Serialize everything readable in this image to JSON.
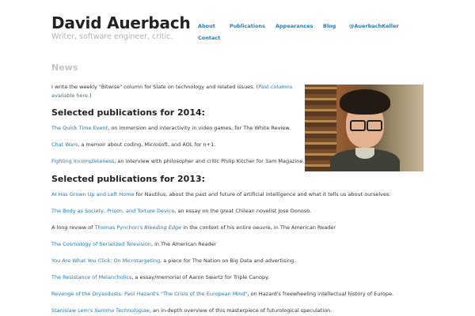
{
  "header": {
    "title": "David Auerbach",
    "tagline": "Writer, software engineer, critic."
  },
  "nav": {
    "about": "About",
    "publications": "Publications",
    "appearances": "Appearances",
    "blog": "Blog",
    "twitter": "@AuerbachKeller",
    "contact": "Contact"
  },
  "main": {
    "section_title": "News",
    "intro": {
      "text_before": "I write the weekly \"Bitwise\" column for Slate on technology and related issues. (",
      "link_line1": "Past columns",
      "link_line2": "available here.",
      "text_after": ")"
    },
    "pubs_2014": {
      "heading": "Selected publications for 2014:",
      "items": [
        {
          "link": "The Quick Time Event",
          "text": ", on immersion and interactivity in video games, for The White Review."
        },
        {
          "link": "Chat Wars",
          "text": ", a memoir about coding, Microsoft, and AOL for n+1."
        },
        {
          "link": "Fighting Incompleteness",
          "text": ", an interview with philosopher and critic Philip Kitcher for 3am Magazine."
        }
      ]
    },
    "pubs_2013": {
      "heading": "Selected publications for 2013:",
      "items": [
        {
          "before": "",
          "link": "AI Has Grown Up and Left Home",
          "link_italic": "",
          "text": " for Nautilus, about the past and future of artificial intelligence and what it tells us about ourselves."
        },
        {
          "before": "",
          "link": "The Body as Society, Prison, and Torture Device",
          "link_italic": "",
          "text": ", an essay on the great Chilean novelist Jose Donoso."
        },
        {
          "before": "A long review of ",
          "link": "Thomas Pynchon's ",
          "link_italic": "Bleeding Edge",
          "text": " in the context of his entire oeuvre, in The American Reader"
        },
        {
          "before": "",
          "link": "The Cosmology of Serialized Television",
          "link_italic": "",
          "text": ", in The American Reader"
        },
        {
          "before": "",
          "link": "You Are What You Click: On Microtargeting",
          "link_italic": "",
          "text": ", a piece for The Nation on Big Data and advertising."
        },
        {
          "before": "",
          "link": "The Resistance of Melancholics",
          "link_italic": "",
          "text": ", a essay/memorial of Aaron Swartz for Triple Canopy."
        },
        {
          "before": "",
          "link": "Revenge of the Dryasdusts: Paul Hazard's \"The Crisis of the European Mind\"",
          "link_italic": "",
          "text": ", on Hazard's freewheeling intellectual history of Europe."
        },
        {
          "before": "",
          "link": "Stanislaw Lem's ",
          "link_italic": "Summa Technologiae",
          "text": ", an in-depth overview of this masterpiece of futurological speculation."
        }
      ]
    }
  },
  "icons": {
    "author_photo": "author-photo"
  }
}
